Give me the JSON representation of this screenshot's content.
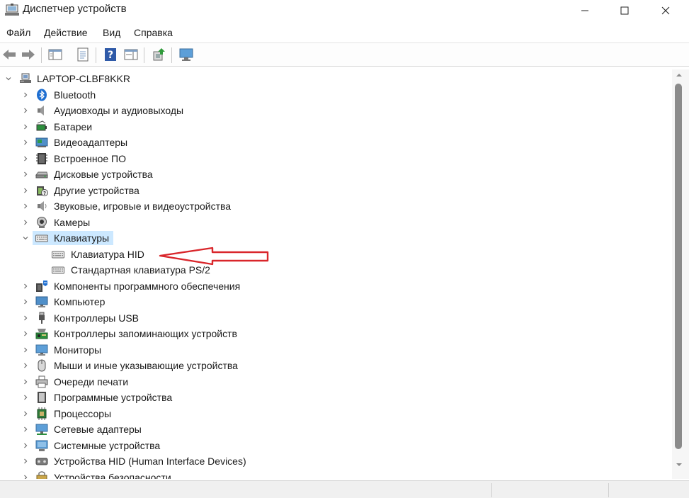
{
  "window": {
    "title": "Диспетчер устройств"
  },
  "menu": [
    "Файл",
    "Действие",
    "Вид",
    "Справка"
  ],
  "toolbar": {
    "buttons": [
      "back-arrow-icon",
      "forward-arrow-icon",
      "show-hide-console-tree-icon",
      "properties-icon",
      "help-icon",
      "action-pane-icon",
      "update-driver-icon",
      "scan-hardware-icon"
    ]
  },
  "tree": {
    "root": "LAPTOP-CLBF8KKR",
    "categories": [
      {
        "label": "Bluetooth",
        "icon": "bluetooth-icon"
      },
      {
        "label": "Аудиовходы и аудиовыходы",
        "icon": "speaker-icon"
      },
      {
        "label": "Батареи",
        "icon": "battery-icon"
      },
      {
        "label": "Видеоадаптеры",
        "icon": "display-adapter-icon"
      },
      {
        "label": "Встроенное ПО",
        "icon": "firmware-icon"
      },
      {
        "label": "Дисковые устройства",
        "icon": "disk-drive-icon"
      },
      {
        "label": "Другие устройства",
        "icon": "unknown-device-icon"
      },
      {
        "label": "Звуковые, игровые и видеоустройства",
        "icon": "sound-device-icon"
      },
      {
        "label": "Камеры",
        "icon": "camera-icon"
      },
      {
        "label": "Клавиатуры",
        "icon": "keyboard-icon",
        "expanded": true,
        "selected": true,
        "children": [
          "Клавиатура HID",
          "Стандартная клавиатура PS/2"
        ]
      },
      {
        "label": "Компоненты программного обеспечения",
        "icon": "software-component-icon"
      },
      {
        "label": "Компьютер",
        "icon": "computer-icon"
      },
      {
        "label": "Контроллеры USB",
        "icon": "usb-icon"
      },
      {
        "label": "Контроллеры запоминающих устройств",
        "icon": "storage-controller-icon"
      },
      {
        "label": "Мониторы",
        "icon": "monitor-icon"
      },
      {
        "label": "Мыши и иные указывающие устройства",
        "icon": "mouse-icon"
      },
      {
        "label": "Очереди печати",
        "icon": "printer-icon"
      },
      {
        "label": "Программные устройства",
        "icon": "software-device-icon"
      },
      {
        "label": "Процессоры",
        "icon": "processor-icon"
      },
      {
        "label": "Сетевые адаптеры",
        "icon": "network-adapter-icon"
      },
      {
        "label": "Системные устройства",
        "icon": "system-device-icon"
      },
      {
        "label": "Устройства HID (Human Interface Devices)",
        "icon": "hid-icon"
      },
      {
        "label": "Устройства безопасности",
        "icon": "security-device-icon"
      }
    ]
  },
  "colors": {
    "selection": "#cce8ff",
    "annotation_arrow": "#d9262b",
    "bluetooth": "#1f6fd1"
  }
}
